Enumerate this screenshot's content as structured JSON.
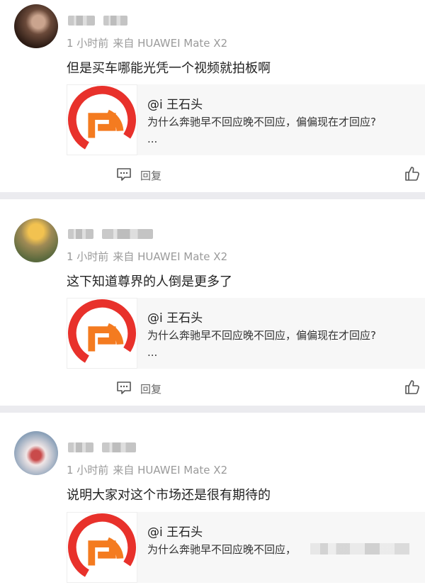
{
  "colors": {
    "separator": "#ebebef",
    "meta_text": "#9a9a9a",
    "logo_red": "#e8312b",
    "logo_orange": "#f47b20"
  },
  "comments": [
    {
      "time": "1 小时前",
      "source": "来自 HUAWEI Mate X2",
      "text": "但是买车哪能光凭一个视频就拍板啊",
      "quote": {
        "author": "@i 王石头",
        "body": "为什么奔驰早不回应晚不回应，偏偏现在才回应?",
        "more": "..."
      },
      "reply_label": "回复",
      "icons": [
        "reply-icon",
        "like-icon"
      ]
    },
    {
      "time": "1 小时前",
      "source": "来自 HUAWEI Mate X2",
      "text": "这下知道尊界的人倒是更多了",
      "quote": {
        "author": "@i 王石头",
        "body": "为什么奔驰早不回应晚不回应，偏偏现在才回应?",
        "more": "..."
      },
      "reply_label": "回复",
      "icons": [
        "reply-icon",
        "like-icon"
      ]
    },
    {
      "time": "1 小时前",
      "source": "来自 HUAWEI Mate X2",
      "text": "说明大家对这个市场还是很有期待的",
      "quote": {
        "author": "@i 王石头",
        "body": "为什么奔驰早不回应晚不回应，",
        "more": ""
      },
      "reply_label": "",
      "icons": []
    }
  ]
}
